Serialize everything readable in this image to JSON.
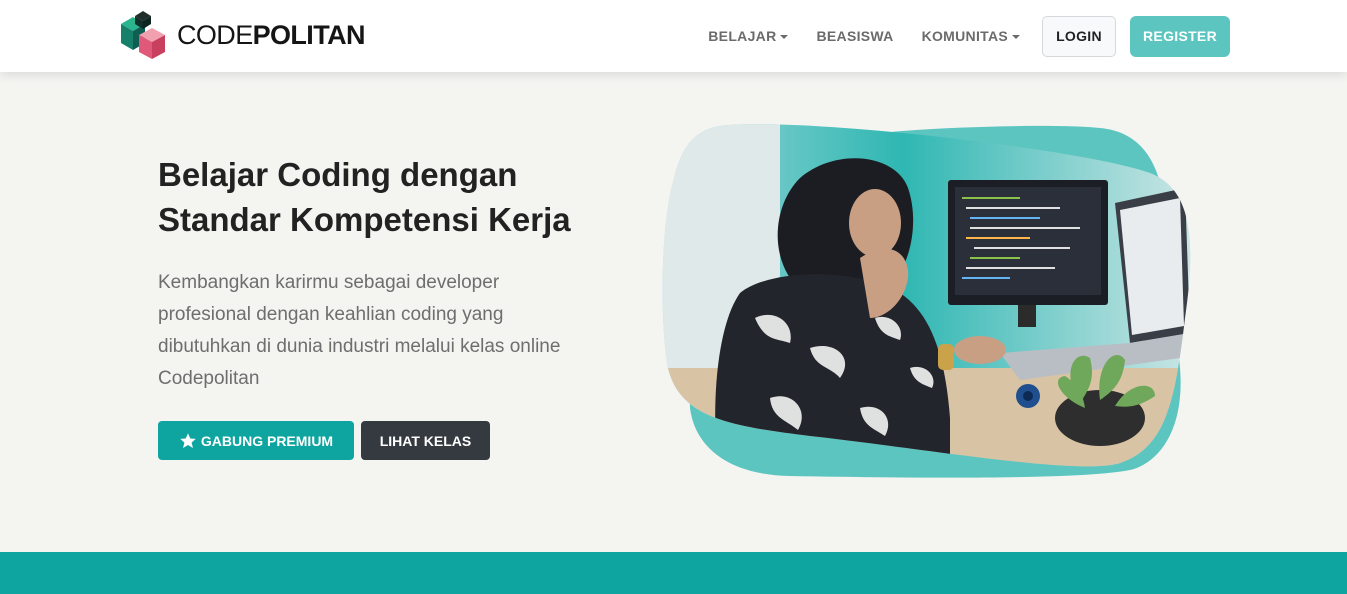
{
  "brand": {
    "name_light": "CODE",
    "name_bold": "POLITAN",
    "logo_icon": "codepolitan-cube-logo"
  },
  "nav": {
    "items": [
      {
        "label": "BELAJAR",
        "dropdown": true
      },
      {
        "label": "BEASISWA",
        "dropdown": false
      },
      {
        "label": "KOMUNITAS",
        "dropdown": true
      }
    ],
    "login_label": "LOGIN",
    "register_label": "REGISTER"
  },
  "hero": {
    "title": "Belajar Coding dengan Standar Kompetensi Kerja",
    "description": "Kembangkan karirmu sebagai developer profesional dengan keahlian coding yang dibutuhkan di dunia industri melalui kelas online Codepolitan",
    "premium_button_label": "GABUNG PREMIUM",
    "premium_button_icon": "star-icon",
    "classes_button_label": "LIHAT KELAS",
    "image": "woman-coding-at-laptop-illustration"
  },
  "colors": {
    "primary_teal": "#0ea5a0",
    "light_teal": "#5cc5c0",
    "dark_button": "#343a40",
    "hero_background": "#f4f4f1",
    "logo_green": "#1e8c76",
    "logo_pink": "#e4738a"
  }
}
